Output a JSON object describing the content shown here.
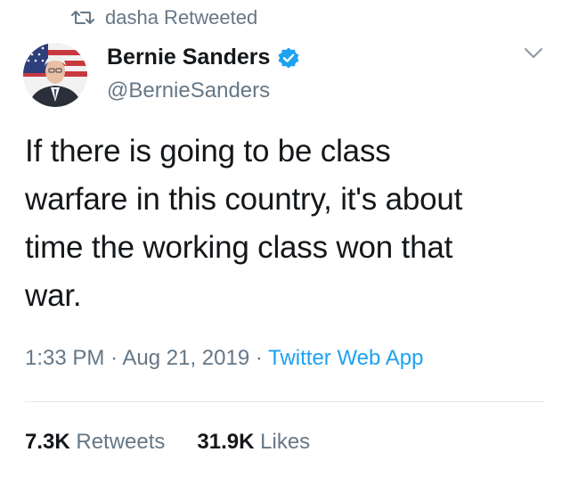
{
  "retweet_banner": {
    "text": "dasha Retweeted",
    "icon": "retweet-icon"
  },
  "author": {
    "name": "Bernie Sanders",
    "handle": "@BernieSanders",
    "verified": true,
    "verified_icon": "verified-badge-icon"
  },
  "tweet": {
    "lines": [
      "If there is going to be class",
      "warfare in this country, it's about",
      "time the working class won that",
      "war."
    ]
  },
  "meta": {
    "time": "1:33 PM",
    "sep1": "·",
    "date": "Aug 21, 2019",
    "sep2": "·",
    "source": "Twitter Web App"
  },
  "stats": {
    "retweets_count": "7.3K",
    "retweets_label": "Retweets",
    "likes_count": "31.9K",
    "likes_label": "Likes"
  },
  "colors": {
    "text": "#14171a",
    "secondary": "#657786",
    "accent": "#1da1f2",
    "divider": "#e1e8ed"
  }
}
